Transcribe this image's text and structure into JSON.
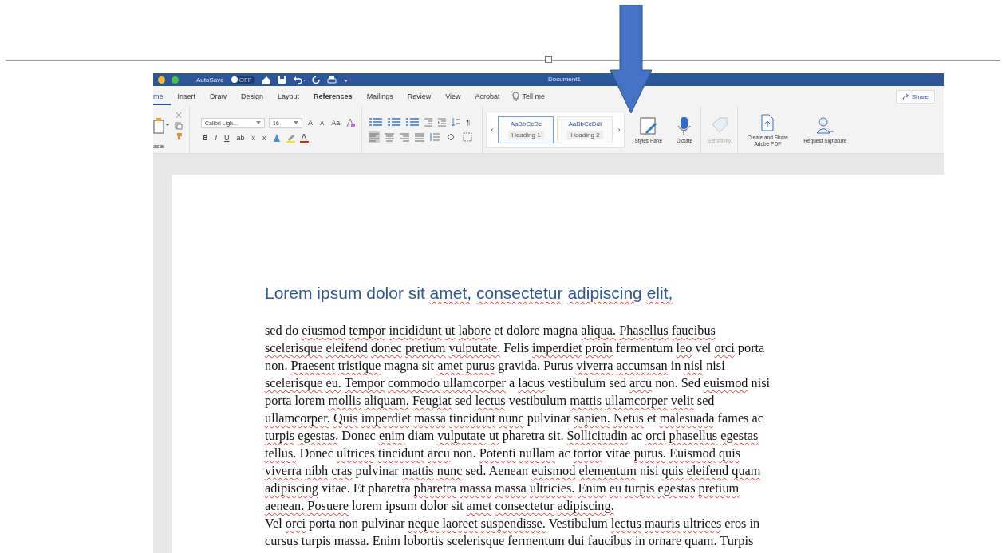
{
  "window": {
    "title": "Document1",
    "autosave_label": "AutoSave",
    "autosave_toggle": {
      "label": "OFF",
      "on": false
    }
  },
  "tabs": [
    {
      "label": "me",
      "selected": true
    },
    {
      "label": "Insert",
      "selected": false
    },
    {
      "label": "Draw",
      "selected": false
    },
    {
      "label": "Design",
      "selected": false
    },
    {
      "label": "Layout",
      "selected": false
    },
    {
      "label": "References",
      "selected": false
    },
    {
      "label": "Mailings",
      "selected": false
    },
    {
      "label": "Review",
      "selected": false
    },
    {
      "label": "View",
      "selected": false
    },
    {
      "label": "Acrobat",
      "selected": false
    }
  ],
  "tell_me": "Tell me",
  "share_button": "Share",
  "clipboard": {
    "paste_label": "aste"
  },
  "font": {
    "name": "Calibri Ligh...",
    "size": "16",
    "row1_buttons": [
      "A",
      "A",
      "Aa"
    ],
    "row2_buttons": [
      "B",
      "I",
      "U",
      "ab",
      "x",
      "x"
    ]
  },
  "paragraph": {
    "pilcrow": "¶",
    "alignment": [
      {
        "selected": true
      },
      {
        "selected": false
      },
      {
        "selected": false
      },
      {
        "selected": false
      }
    ]
  },
  "styles": {
    "prev": "‹",
    "next": "›",
    "items": [
      {
        "sample": "AaBbCcDc",
        "name": "Heading 1",
        "selected": true
      },
      {
        "sample": "AaBbCcDdI",
        "name": "Heading 2",
        "selected": false
      }
    ]
  },
  "ribbon_buttons": [
    {
      "kind": "styles-pane",
      "label": "Styles Pane",
      "disabled": false
    },
    {
      "kind": "dictate",
      "label": "Dictate",
      "disabled": false
    },
    {
      "kind": "sensitivity",
      "label": "Sensitivity",
      "disabled": true
    },
    {
      "kind": "pdf",
      "label": "Create and Share Adobe PDF",
      "disabled": false
    },
    {
      "kind": "signature",
      "label": "Request Signature",
      "disabled": false
    }
  ],
  "document": {
    "heading": [
      {
        "text": "Lorem ipsum dolor sit",
        "flagged": false
      },
      {
        "text": "amet,",
        "flagged": true
      },
      {
        "text": "consectetur",
        "flagged": true
      },
      {
        "text": "adipiscing",
        "flagged": true
      },
      {
        "text": "elit,",
        "flagged": true
      }
    ],
    "paragraphs": [
      {
        "lines": [
          [
            {
              "text": "sed do",
              "flagged": false
            },
            {
              "text": "eiusmod",
              "flagged": true
            },
            {
              "text": "tempor",
              "flagged": true
            },
            {
              "text": "incididunt",
              "flagged": true
            },
            {
              "text": "ut",
              "flagged": true
            },
            {
              "text": "labore",
              "flagged": true
            },
            {
              "text": "et dolore magna",
              "flagged": false
            },
            {
              "text": "aliqua.",
              "flagged": true
            },
            {
              "text": "Phasellus",
              "flagged": true
            },
            {
              "text": "faucibus",
              "flagged": true
            }
          ],
          [
            {
              "text": "scelerisque",
              "flagged": true
            },
            {
              "text": "eleifend",
              "flagged": true
            },
            {
              "text": "donec",
              "flagged": true
            },
            {
              "text": "pretium",
              "flagged": true
            },
            {
              "text": "vulputate.",
              "flagged": true
            },
            {
              "text": "Felis",
              "flagged": false
            },
            {
              "text": "imperdiet",
              "flagged": true
            },
            {
              "text": "proin",
              "flagged": true
            },
            {
              "text": "fermentum",
              "flagged": false
            },
            {
              "text": "leo",
              "flagged": true
            },
            {
              "text": "vel",
              "flagged": false
            },
            {
              "text": "orci",
              "flagged": true
            },
            {
              "text": "porta",
              "flagged": false
            }
          ],
          [
            {
              "text": "non.",
              "flagged": false
            },
            {
              "text": "Praesent",
              "flagged": true
            },
            {
              "text": "tristique",
              "flagged": true
            },
            {
              "text": "magna sit",
              "flagged": false
            },
            {
              "text": "amet",
              "flagged": true
            },
            {
              "text": "purus",
              "flagged": true
            },
            {
              "text": "gravida. Purus",
              "flagged": false
            },
            {
              "text": "viverra",
              "flagged": true
            },
            {
              "text": "accumsan",
              "flagged": true
            },
            {
              "text": "in",
              "flagged": false
            },
            {
              "text": "nisl",
              "flagged": true
            },
            {
              "text": "nisi",
              "flagged": false
            }
          ],
          [
            {
              "text": "scelerisque",
              "flagged": true
            },
            {
              "text": "eu.",
              "flagged": true
            },
            {
              "text": "Tempor",
              "flagged": true
            },
            {
              "text": "commodo",
              "flagged": true
            },
            {
              "text": "ullamcorper",
              "flagged": true
            },
            {
              "text": "a",
              "flagged": false
            },
            {
              "text": "lacus",
              "flagged": true
            },
            {
              "text": "vestibulum sed",
              "flagged": false
            },
            {
              "text": "arcu",
              "flagged": true
            },
            {
              "text": "non. Sed",
              "flagged": false
            },
            {
              "text": "euismod",
              "flagged": true
            },
            {
              "text": "nisi",
              "flagged": false
            }
          ],
          [
            {
              "text": "porta lorem",
              "flagged": false
            },
            {
              "text": "mollis",
              "flagged": true
            },
            {
              "text": "aliquam.",
              "flagged": true
            },
            {
              "text": "Feugiat",
              "flagged": true
            },
            {
              "text": "sed",
              "flagged": false
            },
            {
              "text": "lectus",
              "flagged": true
            },
            {
              "text": "vestibulum",
              "flagged": false
            },
            {
              "text": "mattis",
              "flagged": true
            },
            {
              "text": "ullamcorper",
              "flagged": true
            },
            {
              "text": "velit",
              "flagged": true
            },
            {
              "text": "sed",
              "flagged": false
            }
          ],
          [
            {
              "text": "ullamcorper.",
              "flagged": true
            },
            {
              "text": "Quis",
              "flagged": true
            },
            {
              "text": "imperdiet",
              "flagged": true
            },
            {
              "text": "massa",
              "flagged": true
            },
            {
              "text": "tincidunt",
              "flagged": true
            },
            {
              "text": "nunc",
              "flagged": true
            },
            {
              "text": "pulvinar",
              "flagged": false
            },
            {
              "text": "sapien.",
              "flagged": true
            },
            {
              "text": "Netus",
              "flagged": true
            },
            {
              "text": "et",
              "flagged": false
            },
            {
              "text": "malesuada",
              "flagged": true
            },
            {
              "text": "fames ac",
              "flagged": false
            }
          ],
          [
            {
              "text": "turpis",
              "flagged": true
            },
            {
              "text": "egestas.",
              "flagged": true
            },
            {
              "text": "Donec",
              "flagged": false
            },
            {
              "text": "enim",
              "flagged": true
            },
            {
              "text": "diam",
              "flagged": false
            },
            {
              "text": "vulputate",
              "flagged": true
            },
            {
              "text": "ut",
              "flagged": true
            },
            {
              "text": "pharetra sit.",
              "flagged": false
            },
            {
              "text": "Sollicitudin",
              "flagged": true
            },
            {
              "text": "ac",
              "flagged": false
            },
            {
              "text": "orci",
              "flagged": true
            },
            {
              "text": "phasellus",
              "flagged": true
            },
            {
              "text": "egestas",
              "flagged": true
            }
          ],
          [
            {
              "text": "tellus.",
              "flagged": true
            },
            {
              "text": "Donec",
              "flagged": false
            },
            {
              "text": "ultrices",
              "flagged": true
            },
            {
              "text": "tincidunt",
              "flagged": true
            },
            {
              "text": "arcu",
              "flagged": true
            },
            {
              "text": "non.",
              "flagged": false
            },
            {
              "text": "Potenti",
              "flagged": true
            },
            {
              "text": "nullam",
              "flagged": true
            },
            {
              "text": "ac",
              "flagged": false
            },
            {
              "text": "tortor",
              "flagged": true
            },
            {
              "text": "vitae",
              "flagged": false
            },
            {
              "text": "purus.",
              "flagged": true
            },
            {
              "text": "Euismod",
              "flagged": true
            },
            {
              "text": "quis",
              "flagged": true
            }
          ],
          [
            {
              "text": "viverra",
              "flagged": true
            },
            {
              "text": "nibh",
              "flagged": true
            },
            {
              "text": "cras",
              "flagged": true
            },
            {
              "text": "pulvinar",
              "flagged": false
            },
            {
              "text": "mattis",
              "flagged": true
            },
            {
              "text": "nunc",
              "flagged": true
            },
            {
              "text": "sed. Aenean",
              "flagged": false
            },
            {
              "text": "euismod",
              "flagged": true
            },
            {
              "text": "elementum",
              "flagged": true
            },
            {
              "text": "nisi",
              "flagged": false
            },
            {
              "text": "quis",
              "flagged": true
            },
            {
              "text": "eleifend",
              "flagged": true
            },
            {
              "text": "quam",
              "flagged": true
            }
          ],
          [
            {
              "text": "adipiscing",
              "flagged": true
            },
            {
              "text": "vitae. Et pharetra",
              "flagged": false
            },
            {
              "text": "pharetra",
              "flagged": true
            },
            {
              "text": "massa",
              "flagged": true
            },
            {
              "text": "massa",
              "flagged": true
            },
            {
              "text": "ultricies.",
              "flagged": true
            },
            {
              "text": "Enim",
              "flagged": true
            },
            {
              "text": "eu",
              "flagged": true
            },
            {
              "text": "turpis",
              "flagged": true
            },
            {
              "text": "egestas",
              "flagged": true
            },
            {
              "text": "pretium",
              "flagged": true
            }
          ],
          [
            {
              "text": "aenean.",
              "flagged": true
            },
            {
              "text": "Posuere",
              "flagged": true
            },
            {
              "text": "lorem ipsum dolor sit",
              "flagged": false
            },
            {
              "text": "amet",
              "flagged": true
            },
            {
              "text": "consectetur",
              "flagged": true
            },
            {
              "text": "adipiscing.",
              "flagged": true
            }
          ]
        ]
      },
      {
        "lines": [
          [
            {
              "text": "Vel",
              "flagged": false
            },
            {
              "text": "orci",
              "flagged": true
            },
            {
              "text": "porta non pulvinar",
              "flagged": false
            },
            {
              "text": "neque",
              "flagged": true
            },
            {
              "text": "laoreet",
              "flagged": true
            },
            {
              "text": "suspendisse.",
              "flagged": true
            },
            {
              "text": "Vestibulum",
              "flagged": false
            },
            {
              "text": "lectus",
              "flagged": true
            },
            {
              "text": "mauris",
              "flagged": true
            },
            {
              "text": "ultrices",
              "flagged": true
            },
            {
              "text": "eros in",
              "flagged": false
            }
          ],
          [
            {
              "text": "cursus turpis massa. Enim lobortis scelerisque fermentum dui faucibus in ornare quam. Turpis",
              "flagged": false
            }
          ]
        ]
      }
    ]
  }
}
